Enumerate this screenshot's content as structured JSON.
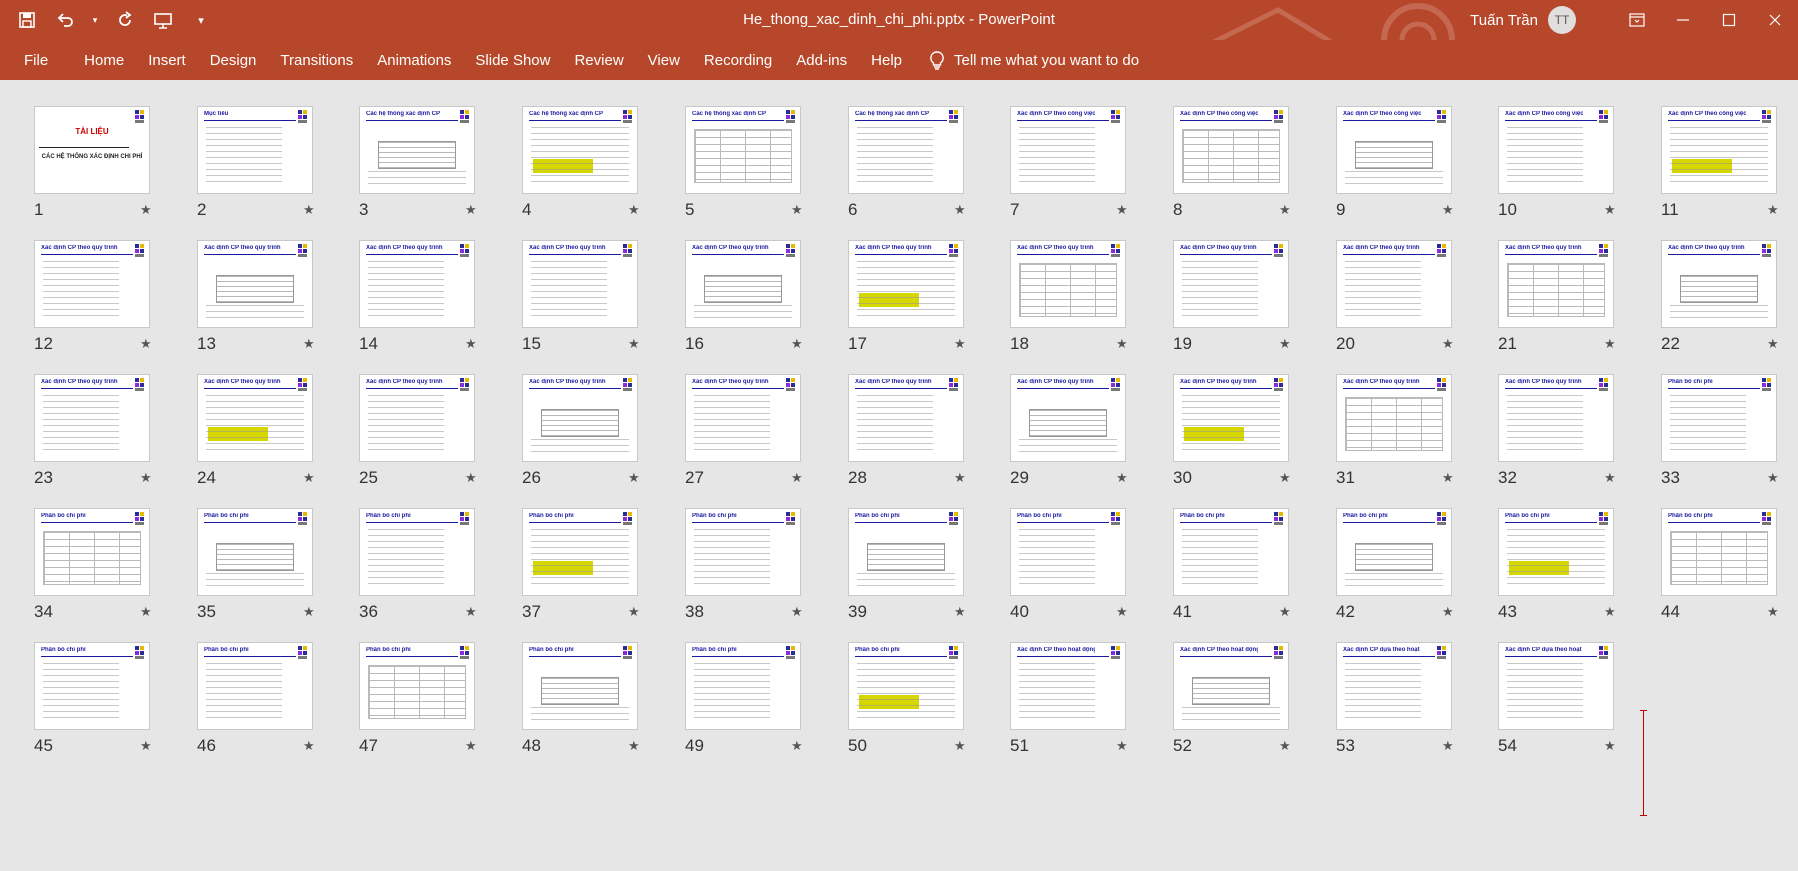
{
  "window": {
    "title": "He_thong_xac_dinh_chi_phi.pptx  -  PowerPoint",
    "user_name": "Tuấn Trần",
    "user_initials": "TT"
  },
  "quick_access": {
    "icons": [
      "save-icon",
      "undo-icon",
      "redo-icon",
      "present-icon",
      "customize-icon"
    ]
  },
  "ribbon": {
    "tabs": [
      "File",
      "Home",
      "Insert",
      "Design",
      "Transitions",
      "Animations",
      "Slide Show",
      "Review",
      "View",
      "Recording",
      "Add-ins",
      "Help"
    ],
    "tell_me": "Tell me what you want to do"
  },
  "colors": {
    "accent": "#b7472a",
    "background": "#e6e6e6"
  },
  "slides": [
    {
      "num": "1",
      "title": "TÀI LIỆU",
      "subtitle": "CÁC HỆ THỐNG XÁC ĐỊNH CHI PHÍ"
    },
    {
      "num": "2",
      "title": "Mục tiêu"
    },
    {
      "num": "3",
      "title": "Các hệ thống xác định CP"
    },
    {
      "num": "4",
      "title": "Các hệ thống xác định CP"
    },
    {
      "num": "5",
      "title": "Các hệ thống xác định CP"
    },
    {
      "num": "6",
      "title": "Các hệ thống xác định CP"
    },
    {
      "num": "7",
      "title": "Xác định CP theo công việc"
    },
    {
      "num": "8",
      "title": "Xác định CP theo công việc"
    },
    {
      "num": "9",
      "title": "Xác định CP theo công việc"
    },
    {
      "num": "10",
      "title": "Xác định CP theo công việc"
    },
    {
      "num": "11",
      "title": "Xác định CP theo công việc"
    },
    {
      "num": "12",
      "title": "Xác định CP theo quy trình"
    },
    {
      "num": "13",
      "title": "Xác định CP theo quy trình"
    },
    {
      "num": "14",
      "title": "Xác định CP theo quy trình"
    },
    {
      "num": "15",
      "title": "Xác định CP theo quy trình"
    },
    {
      "num": "16",
      "title": "Xác định CP theo quy trình"
    },
    {
      "num": "17",
      "title": "Xác định CP theo quy trình"
    },
    {
      "num": "18",
      "title": "Xác định CP theo quy trình"
    },
    {
      "num": "19",
      "title": "Xác định CP theo quy trình"
    },
    {
      "num": "20",
      "title": "Xác định CP theo quy trình"
    },
    {
      "num": "21",
      "title": "Xác định CP theo quy trình"
    },
    {
      "num": "22",
      "title": "Xác định CP theo quy trình"
    },
    {
      "num": "23",
      "title": "Xác định CP theo quy trình"
    },
    {
      "num": "24",
      "title": "Xác định CP theo quy trình"
    },
    {
      "num": "25",
      "title": "Xác định CP theo quy trình"
    },
    {
      "num": "26",
      "title": "Xác định CP theo quy trình"
    },
    {
      "num": "27",
      "title": "Xác định CP theo quy trình"
    },
    {
      "num": "28",
      "title": "Xác định CP theo quy trình"
    },
    {
      "num": "29",
      "title": "Xác định CP theo quy trình"
    },
    {
      "num": "30",
      "title": "Xác định CP theo quy trình"
    },
    {
      "num": "31",
      "title": "Xác định CP theo quy trình"
    },
    {
      "num": "32",
      "title": "Xác định CP theo quy trình"
    },
    {
      "num": "33",
      "title": "Phân bổ chi phí"
    },
    {
      "num": "34",
      "title": "Phân bổ chi phí"
    },
    {
      "num": "35",
      "title": "Phân bổ chi phí"
    },
    {
      "num": "36",
      "title": "Phân bổ chi phí"
    },
    {
      "num": "37",
      "title": "Phân bổ chi phí"
    },
    {
      "num": "38",
      "title": "Phân bổ chi phí"
    },
    {
      "num": "39",
      "title": "Phân bổ chi phí"
    },
    {
      "num": "40",
      "title": "Phân bổ chi phí"
    },
    {
      "num": "41",
      "title": "Phân bổ chi phí"
    },
    {
      "num": "42",
      "title": "Phân bổ chi phí"
    },
    {
      "num": "43",
      "title": "Phân bổ chi phí"
    },
    {
      "num": "44",
      "title": "Phân bổ chi phí"
    },
    {
      "num": "45",
      "title": "Phân bổ chi phí"
    },
    {
      "num": "46",
      "title": "Phân bổ chi phí"
    },
    {
      "num": "47",
      "title": "Phân bổ chi phí"
    },
    {
      "num": "48",
      "title": "Phân bổ chi phí"
    },
    {
      "num": "49",
      "title": "Phân bổ chi phí"
    },
    {
      "num": "50",
      "title": "Phân bổ chi phí"
    },
    {
      "num": "51",
      "title": "Xác định CP theo hoạt động"
    },
    {
      "num": "52",
      "title": "Xác định CP theo hoạt động"
    },
    {
      "num": "53",
      "title": "Xác định CP dựa theo hoạt động"
    },
    {
      "num": "54",
      "title": "Xác định CP dựa theo hoạt động"
    }
  ]
}
